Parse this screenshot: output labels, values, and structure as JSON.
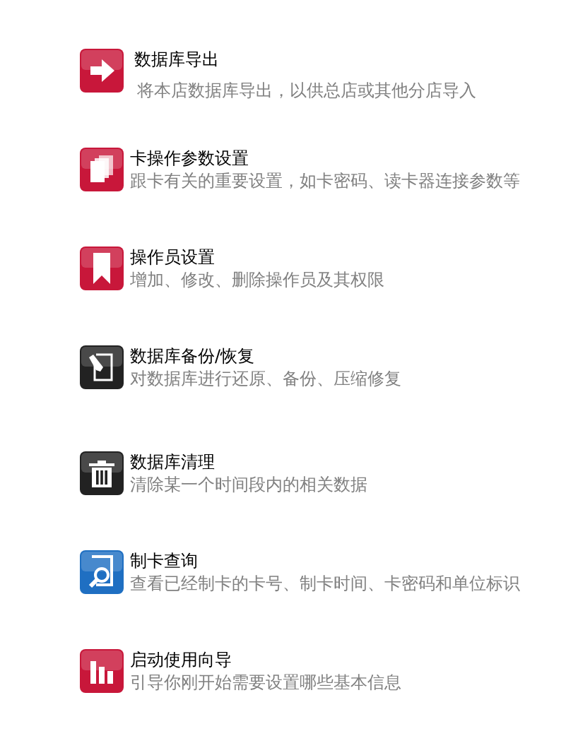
{
  "items": [
    {
      "kind": "arrow",
      "color": "#c8173a",
      "title": "数据库导出",
      "description": "将本店数据库导出，以供总店或其他分店导入"
    },
    {
      "kind": "pages",
      "color": "#c8173a",
      "title": "卡操作参数设置",
      "description": "跟卡有关的重要设置，如卡密码、读卡器连接参数等"
    },
    {
      "kind": "bookmark",
      "color": "#c8173a",
      "title": "操作员设置",
      "description": "增加、修改、删除操作员及其权限"
    },
    {
      "kind": "edit",
      "color": "#222222",
      "title": "数据库备份/恢复",
      "description": "对数据库进行还原、备份、压缩修复"
    },
    {
      "kind": "trash",
      "color": "#222222",
      "title": "数据库清理",
      "description": "清除某一个时间段内的相关数据"
    },
    {
      "kind": "search",
      "color": "#1f6fc2",
      "title": "制卡查询",
      "description": "查看已经制卡的卡号、制卡时间、卡密码和单位标识"
    },
    {
      "kind": "bars",
      "color": "#c8173a",
      "title": "启动使用向导",
      "description": "引导你刚开始需要设置哪些基本信息"
    }
  ]
}
